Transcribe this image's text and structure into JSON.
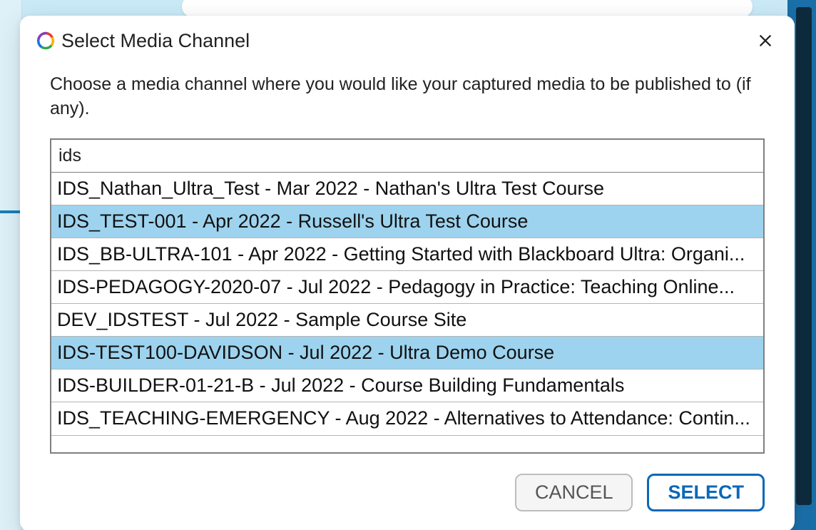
{
  "dialog": {
    "title": "Select Media Channel",
    "instruction": "Choose a media channel where you would like your captured media to be published to (if any).",
    "search_value": "ids",
    "items": [
      {
        "label": "IDS_Nathan_Ultra_Test - Mar 2022 - Nathan's Ultra Test Course",
        "selected": false
      },
      {
        "label": "IDS_TEST-001 - Apr 2022 - Russell's Ultra Test Course",
        "selected": true
      },
      {
        "label": "IDS_BB-ULTRA-101 - Apr 2022 - Getting Started with Blackboard Ultra: Organi...",
        "selected": false
      },
      {
        "label": "IDS-PEDAGOGY-2020-07 - Jul 2022 - Pedagogy in Practice: Teaching Online...",
        "selected": false
      },
      {
        "label": "DEV_IDSTEST - Jul 2022 - Sample Course Site",
        "selected": false
      },
      {
        "label": "IDS-TEST100-DAVIDSON - Jul 2022 - Ultra Demo Course",
        "selected": true
      },
      {
        "label": "IDS-BUILDER-01-21-B - Jul 2022 - Course Building Fundamentals",
        "selected": false
      },
      {
        "label": "IDS_TEACHING-EMERGENCY - Aug 2022 - Alternatives to Attendance: Contin...",
        "selected": false
      }
    ],
    "cancel_label": "CANCEL",
    "select_label": "SELECT"
  }
}
